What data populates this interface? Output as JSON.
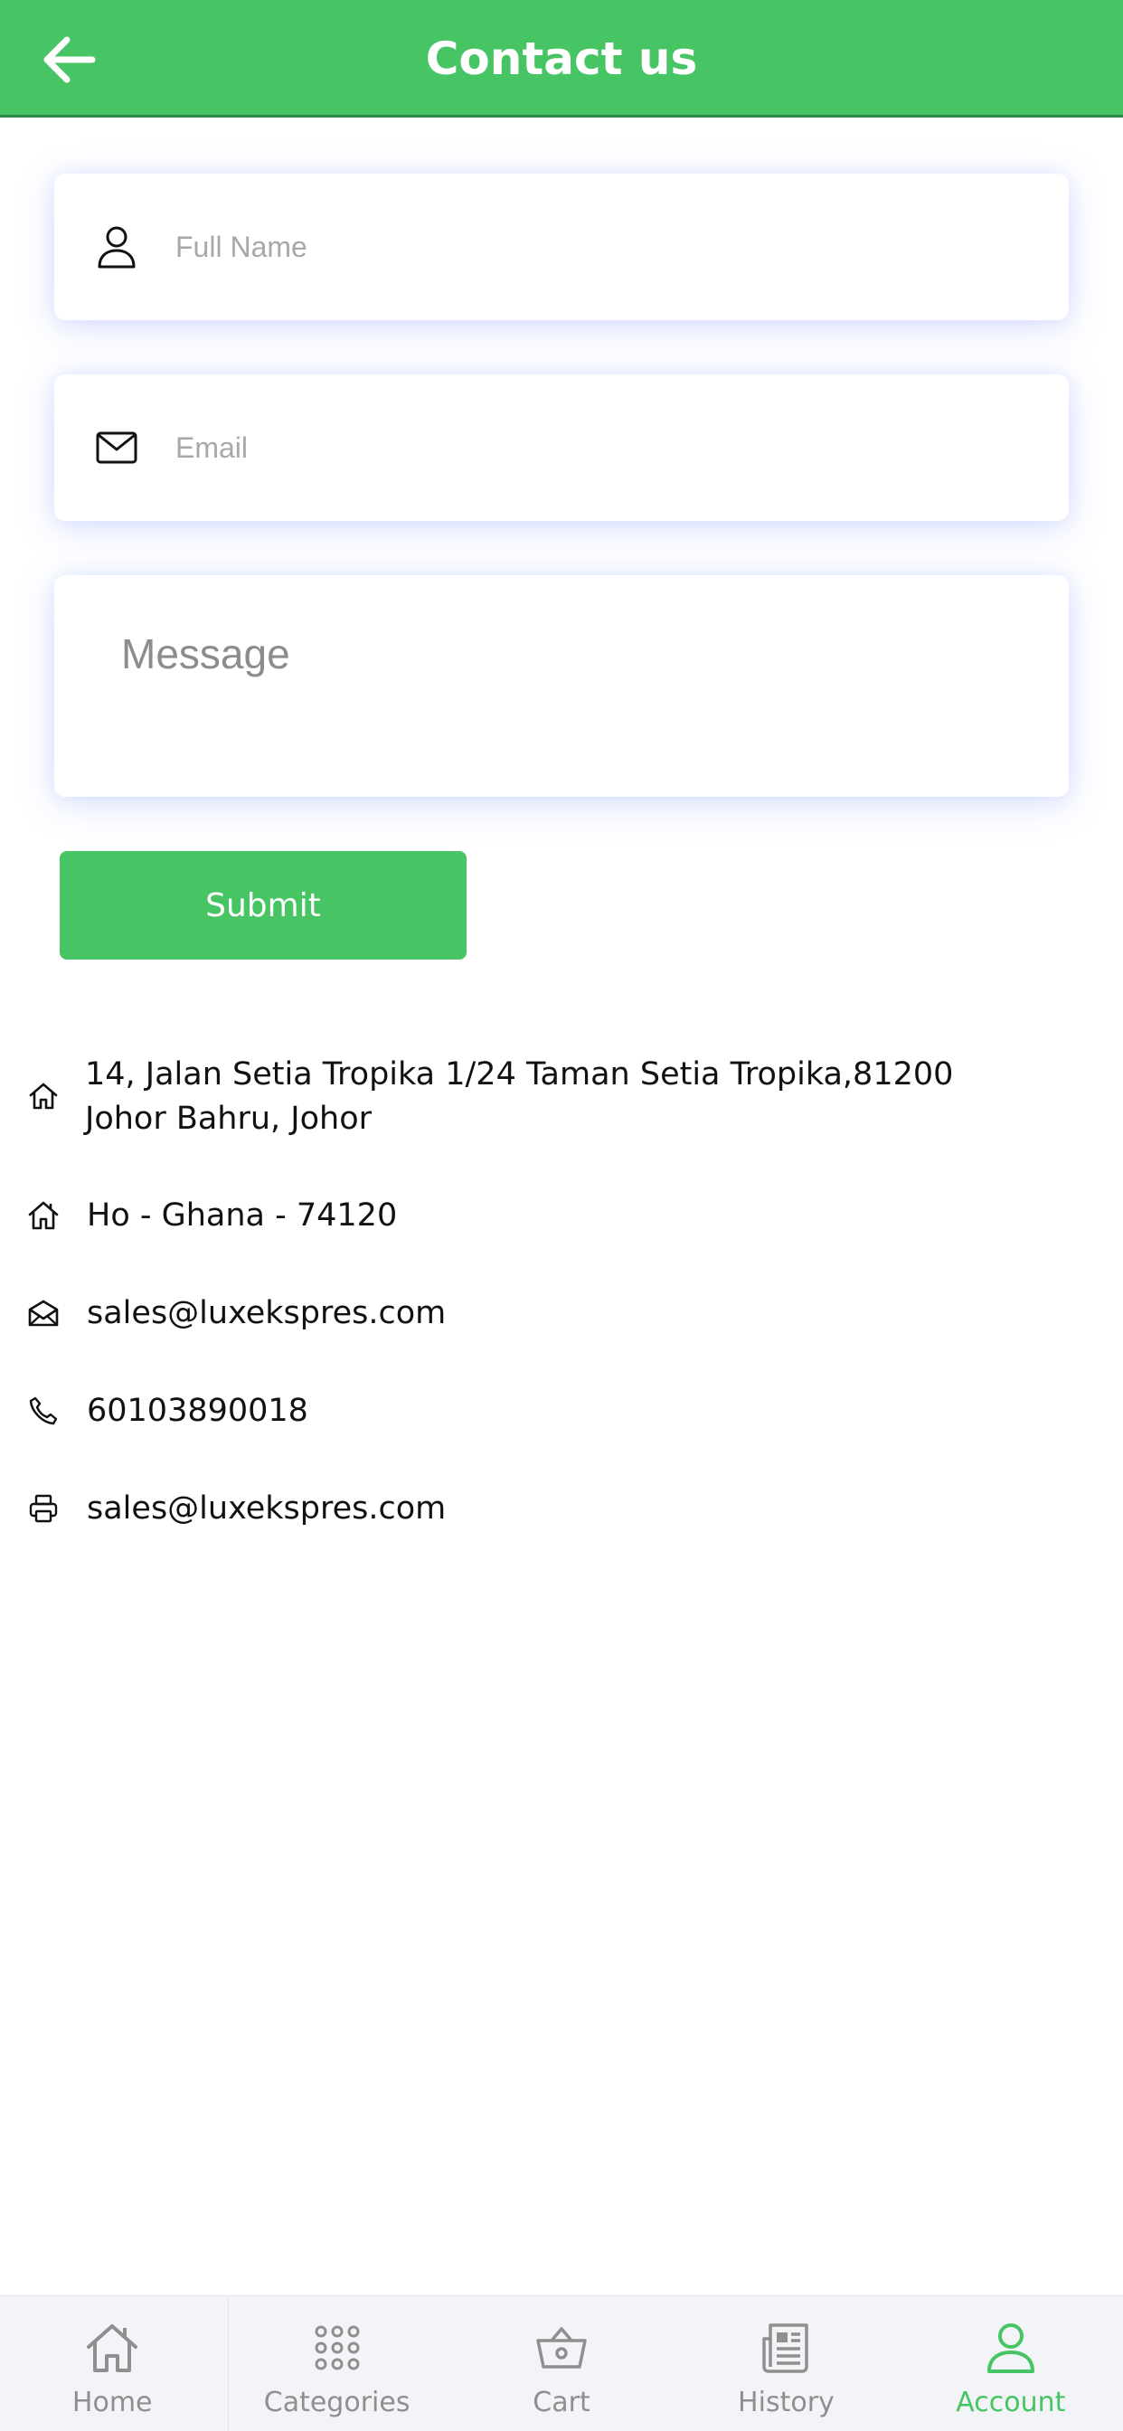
{
  "header": {
    "title": "Contact us",
    "back_icon": "arrow-left-icon"
  },
  "form": {
    "name_placeholder": "Full Name",
    "email_placeholder": "Email",
    "message_placeholder": "Message",
    "submit_label": "Submit"
  },
  "contact": {
    "address": "14, Jalan Setia Tropika 1/24 Taman Setia Tropika,81200 Johor Bahru, Johor",
    "city": "Ho - Ghana - 74120",
    "email": "sales@luxekspres.com",
    "phone": "60103890018",
    "fax": "sales@luxekspres.com"
  },
  "nav": {
    "items": [
      {
        "label": "Home",
        "icon": "home-icon"
      },
      {
        "label": "Categories",
        "icon": "grid-icon"
      },
      {
        "label": "Cart",
        "icon": "basket-icon"
      },
      {
        "label": "History",
        "icon": "newspaper-icon"
      },
      {
        "label": "Account",
        "icon": "user-icon"
      }
    ],
    "active": "Account"
  },
  "colors": {
    "brand": "#47c463",
    "text": "#111111",
    "placeholder": "#a8a8a8",
    "nav_inactive": "#8f8f8f",
    "nav_bg": "#f3f4f7"
  }
}
